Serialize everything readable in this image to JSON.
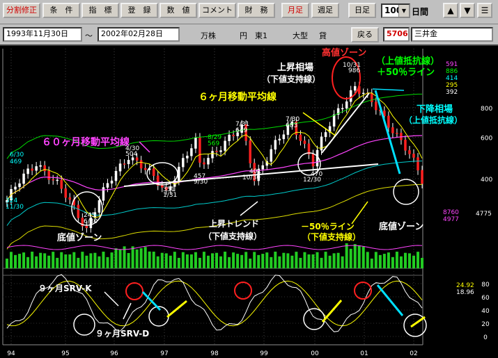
{
  "toolbar": {
    "buttons": [
      {
        "label": "分割修正",
        "red": true
      },
      {
        "label": "条　件",
        "red": false
      },
      {
        "label": "指　標",
        "red": false
      },
      {
        "label": "登　録",
        "red": false
      },
      {
        "label": "数　値",
        "red": false
      },
      {
        "label": "コメント",
        "red": false
      },
      {
        "label": "財　務",
        "red": false
      },
      {
        "label": "月足",
        "red": true
      },
      {
        "label": "週足",
        "red": false
      },
      {
        "label": "日足",
        "red": false
      }
    ],
    "period_value": "100",
    "period_unit": "日間",
    "up_arrow": "▲",
    "down_arrow": "▼",
    "menu_glyph": "☰"
  },
  "infobar": {
    "start_date": "1993年11月30日",
    "separator": "～",
    "end_date": "2002年02月28日",
    "unit_shares": "万株",
    "unit_yen": "円",
    "market": "東1",
    "size": "大型",
    "credit": "貸",
    "back_label": "戻る",
    "code": "5706",
    "name": "三井金"
  },
  "chart_data": {
    "type": "candlestick",
    "price_axis": {
      "ticks": [
        400,
        600,
        800
      ],
      "range": [
        230,
        1000
      ]
    },
    "upper_right_values": [
      {
        "text": "591",
        "color": "#ff44ff"
      },
      {
        "text": "886",
        "color": "#00ff00"
      },
      {
        "text": "414",
        "color": "#00ffff"
      },
      {
        "text": "295",
        "color": "#ffff00"
      },
      {
        "text": "392",
        "color": "#ffffff"
      }
    ],
    "volume_values": [
      {
        "text": "8760",
        "color": "#ff44ff"
      },
      {
        "text": "4977",
        "color": "#ff44ff"
      }
    ],
    "volume_axis_label": "4775",
    "osc_values": [
      {
        "text": "24.92",
        "color": "#ffff00"
      },
      {
        "text": "18.96",
        "color": "#ffffff"
      }
    ],
    "osc_axis": [
      "80",
      "60",
      "40",
      "20",
      "0"
    ],
    "x_ticks": [
      "94",
      "95",
      "96",
      "97",
      "98",
      "99",
      "00",
      "01",
      "02"
    ],
    "price_labels": [
      {
        "text": "324",
        "color": "#00ffff"
      },
      {
        "text": "11/30",
        "color": "#00ffff"
      },
      {
        "text": "6/30",
        "color": "#00ffff"
      },
      {
        "text": "469",
        "color": "#00ffff"
      },
      {
        "text": "245",
        "color": "#ffffff"
      },
      {
        "text": "6/30",
        "color": "#ffffff"
      },
      {
        "text": "4/30",
        "color": "#ffffff"
      },
      {
        "text": "504",
        "color": "#ffffff"
      },
      {
        "text": "351",
        "color": "#ffffff"
      },
      {
        "text": "1/31",
        "color": "#ffffff"
      },
      {
        "text": "457",
        "color": "#ffffff"
      },
      {
        "text": "9/30",
        "color": "#ffffff"
      },
      {
        "text": "8/29",
        "color": "#00ff00"
      },
      {
        "text": "569",
        "color": "#00ff00"
      },
      {
        "text": "7/31",
        "color": "#ffffff"
      },
      {
        "text": "649",
        "color": "#ffffff"
      },
      {
        "text": "401",
        "color": "#ffffff"
      },
      {
        "text": "10/30",
        "color": "#ffffff"
      },
      {
        "text": "7/30",
        "color": "#ffffff"
      },
      {
        "text": "683",
        "color": "#ffffff"
      },
      {
        "text": "470",
        "color": "#ffffff"
      },
      {
        "text": "12/30",
        "color": "#ffffff"
      },
      {
        "text": "10/31",
        "color": "#ffffff"
      },
      {
        "text": "986",
        "color": "#ffffff"
      }
    ],
    "annotations": [
      {
        "text": "高値ゾーン",
        "color": "#ff3030"
      },
      {
        "text": "（上値抵抗線）",
        "color": "#00ff00"
      },
      {
        "text": "＋50％ライン",
        "color": "#00ff00"
      },
      {
        "text": "上昇相場",
        "color": "#ffffff"
      },
      {
        "text": "（下値支持線）",
        "color": "#ffffff"
      },
      {
        "text": "６ヶ月移動平均線",
        "color": "#ffff00"
      },
      {
        "text": "下降相場",
        "color": "#00ffff"
      },
      {
        "text": "（上値抵抗線）",
        "color": "#00ffff"
      },
      {
        "text": "６０ヶ月移動平均線",
        "color": "#ff44ff"
      },
      {
        "text": "上昇トレンド",
        "color": "#ffffff"
      },
      {
        "text": "（下値支持線）",
        "color": "#ffffff"
      },
      {
        "text": "－50％ライン",
        "color": "#ffff00"
      },
      {
        "text": "（下値支持線）",
        "color": "#ffff00"
      },
      {
        "text": "底値ゾーン",
        "color": "#ffffff"
      },
      {
        "text": "底値ゾーン",
        "color": "#ffffff"
      },
      {
        "text": "９ヶ月SRV-K",
        "color": "#ffffff"
      },
      {
        "text": "９ヶ月SRV-D",
        "color": "#ffffff"
      }
    ],
    "key_prices": [
      {
        "date": "1993-11",
        "price": 324
      },
      {
        "date": "1994-06",
        "price": 469
      },
      {
        "date": "1995-06",
        "price": 245
      },
      {
        "date": "1996-04",
        "price": 504
      },
      {
        "date": "1997-01",
        "price": 351
      },
      {
        "date": "1997-09",
        "price": 457
      },
      {
        "date": "1997-08",
        "price": 569
      },
      {
        "date": "1998-07",
        "price": 649
      },
      {
        "date": "1998-10",
        "price": 401
      },
      {
        "date": "1999-07",
        "price": 683
      },
      {
        "date": "1999-12",
        "price": 470
      },
      {
        "date": "2000-10",
        "price": 986
      },
      {
        "date": "2002-02",
        "price": 392
      }
    ]
  }
}
